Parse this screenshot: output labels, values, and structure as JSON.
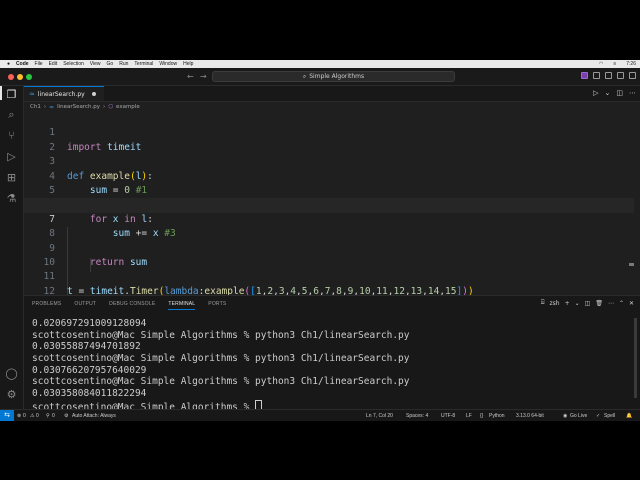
{
  "menubar": {
    "app": "Code",
    "items": [
      "File",
      "Edit",
      "Selection",
      "View",
      "Go",
      "Run",
      "Terminal",
      "Window",
      "Help"
    ],
    "clock": "7:26"
  },
  "window": {
    "search": "Simple Algorithms"
  },
  "tab": {
    "filename": "linearSearch.py"
  },
  "breadcrumb": {
    "folder": "Ch1",
    "file": "linearSearch.py",
    "symbol": "example"
  },
  "editor": {
    "current_line": 7,
    "line_numbers": [
      "1",
      "2",
      "3",
      "4",
      "5",
      "6",
      "7",
      "8",
      "9",
      "10",
      "11",
      "12"
    ]
  },
  "panel": {
    "tabs": [
      "PROBLEMS",
      "OUTPUT",
      "DEBUG CONSOLE",
      "TERMINAL",
      "PORTS"
    ],
    "active_tab": "TERMINAL",
    "shell": "zsh",
    "terminal_lines": [
      "0.020697291009128094",
      "scottcosentino@Mac Simple Algorithms % python3 Ch1/linearSearch.py",
      "0.03055887494701892",
      "scottcosentino@Mac Simple Algorithms % python3 Ch1/linearSearch.py",
      "0.030766207957640029",
      "scottcosentino@Mac Simple Algorithms % python3 Ch1/linearSearch.py",
      "0.030358084011822294"
    ],
    "prompt": "scottcosentino@Mac Simple Algorithms % "
  },
  "status": {
    "errors": "0",
    "warnings": "0",
    "ports": "0",
    "auto_attach": "Auto Attach: Always",
    "position": "Ln 7, Col 20",
    "spaces": "Spaces: 4",
    "encoding": "UTF-8",
    "eol": "LF",
    "language": "Python",
    "interpreter": "3.13.0 64-bit",
    "golive": "Go Live",
    "spell": "Spell"
  },
  "colors": {
    "accent": "#0078d4",
    "keyword": "#c586c0",
    "function": "#dcdcaa",
    "comment": "#6a9955",
    "number": "#b5cea8"
  }
}
